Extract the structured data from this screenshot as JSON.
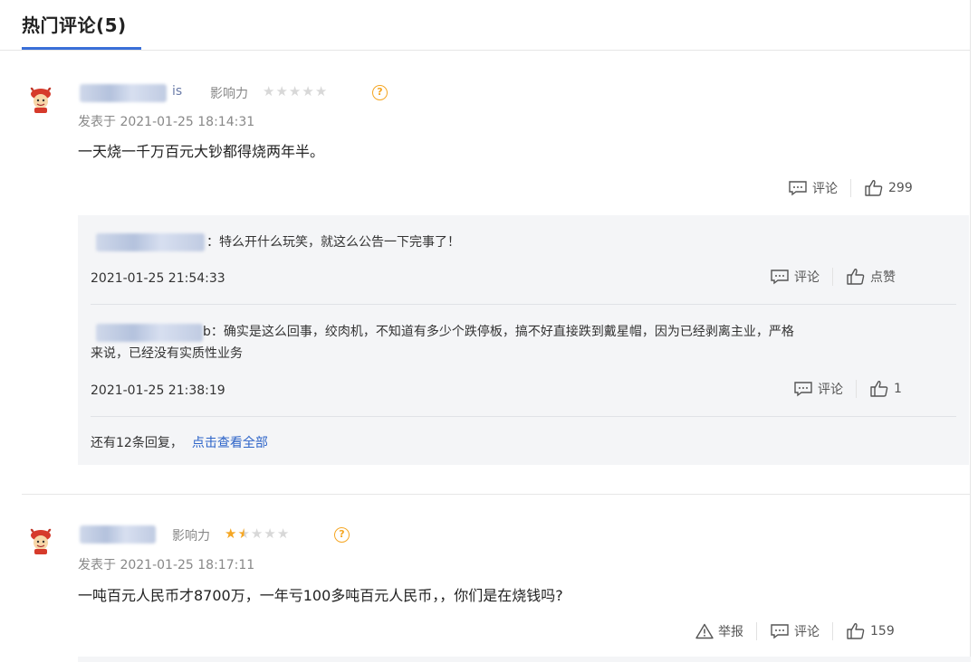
{
  "header": {
    "title": "热门评论(5)"
  },
  "colors": {
    "accent": "#3a6fd8",
    "star_on": "#f5a623",
    "star_off": "#d8d8d8",
    "link": "#2d64c8"
  },
  "comments": [
    {
      "name_tail": "is",
      "influence_label": "影响力",
      "stars": 0,
      "help": "?",
      "posted": "发表于 2021-01-25 18:14:31",
      "text": "一天烧一千万百元大钞都得烧两年半。",
      "comment_label": "评论",
      "likes": "299",
      "replies": [
        {
          "text": "：特么开什么玩笑，就这么公告一下完事了！",
          "time": "2021-01-25 21:54:33",
          "comment_label": "评论",
          "like_label": "点赞"
        },
        {
          "text_line1": "b：确实是这么回事，绞肉机，不知道有多少个跌停板，搞不好直接跌到戴星帽，因为已经剥离主业，严格",
          "text_line2": "来说，已经没有实质性业务",
          "time": "2021-01-25 21:38:19",
          "comment_label": "评论",
          "like_label": "1"
        }
      ],
      "more_text": "还有12条回复，",
      "more_link": "点击查看全部"
    },
    {
      "influence_label": "影响力",
      "stars": 1.5,
      "help": "?",
      "posted": "发表于 2021-01-25 18:17:11",
      "text": "一吨百元人民币才8700万，一年亏100多吨百元人民币，，你们是在烧钱吗?",
      "report_label": "举报",
      "comment_label": "评论",
      "likes": "159"
    }
  ],
  "icons": [
    "avatar-icon",
    "comment-icon",
    "thumbs-up-icon",
    "report-warning-icon",
    "help-icon",
    "star-icon"
  ]
}
